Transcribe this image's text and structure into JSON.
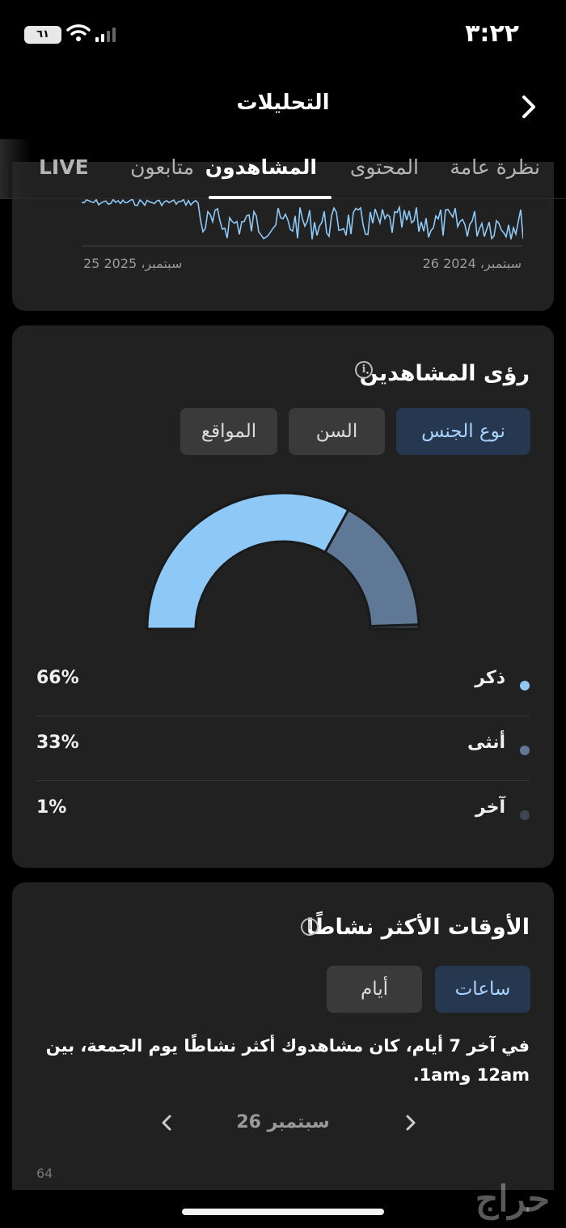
{
  "status_bar": {
    "time": "٣:٢٢",
    "battery": "٦١"
  },
  "header": {
    "title": "التحليلات",
    "back_icon": "chevron-right-icon"
  },
  "tabs": [
    {
      "label": "نظرة عامة",
      "active": false
    },
    {
      "label": "المحتوى",
      "active": false
    },
    {
      "label": "المشاهدون",
      "active": true
    },
    {
      "label": "متابعون",
      "active": false
    },
    {
      "label": "LIVE",
      "active": false
    }
  ],
  "views_chart": {
    "start_date": "سبتمبر، 2024 26",
    "end_date": "سبتمبر، 2025 25",
    "line_color": "#8ec8f6"
  },
  "viewer_insights": {
    "title": "رؤى المشاهدين",
    "filters": [
      {
        "label": "نوع الجنس",
        "selected": true
      },
      {
        "label": "السن",
        "selected": false
      },
      {
        "label": "المواقع",
        "selected": false
      }
    ],
    "gender": [
      {
        "label": "ذكر",
        "value": "66%",
        "share": 66,
        "color": "#8ec8f6"
      },
      {
        "label": "أنثى",
        "value": "33%",
        "share": 33,
        "color": "#5f7896"
      },
      {
        "label": "آخر",
        "value": "1%",
        "share": 1,
        "color": "#3e4651"
      }
    ]
  },
  "active_times": {
    "title": "الأوقات الأكثر نشاطًا",
    "filters": [
      {
        "label": "ساعات",
        "selected": true
      },
      {
        "label": "أيام",
        "selected": false
      }
    ],
    "description": "في آخر 7 أيام، كان مشاهدوك أكثر نشاطًا يوم الجمعة، بين 12am و1am.",
    "date": "26 سبتمبر",
    "cut_value": "64"
  },
  "watermark": "حراج"
}
